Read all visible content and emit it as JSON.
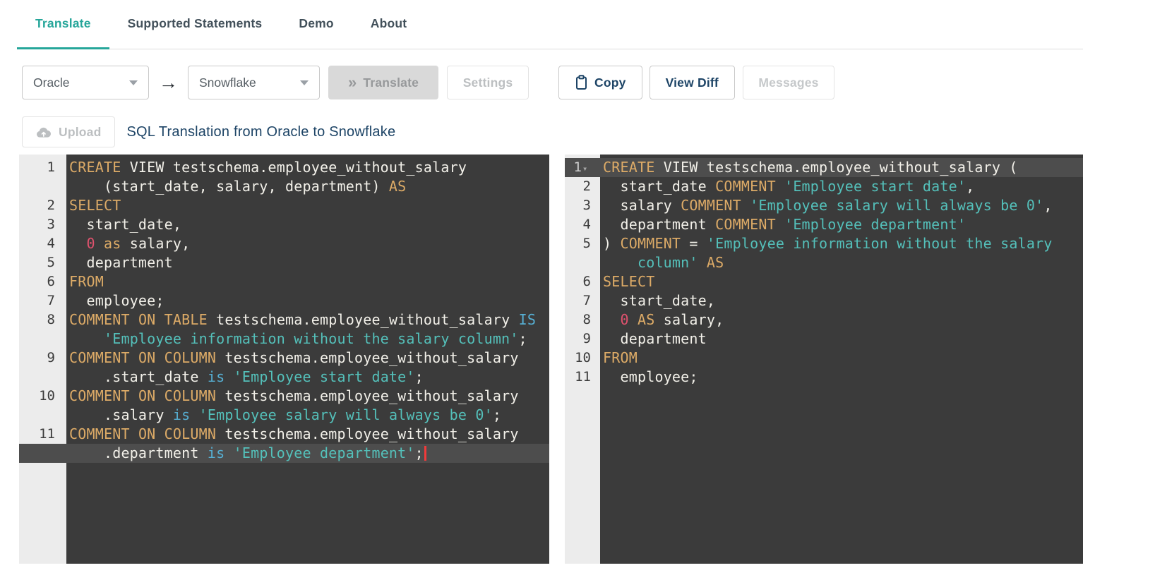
{
  "tabs": [
    {
      "label": "Translate",
      "active": true
    },
    {
      "label": "Supported Statements",
      "active": false
    },
    {
      "label": "Demo",
      "active": false
    },
    {
      "label": "About",
      "active": false
    }
  ],
  "toolbar": {
    "source_dialect": "Oracle",
    "target_dialect": "Snowflake",
    "arrow": "→",
    "translate_icon": "»",
    "translate_label": "Translate",
    "settings_label": "Settings",
    "copy_label": "Copy",
    "view_diff_label": "View Diff",
    "messages_label": "Messages"
  },
  "subheader": {
    "upload_label": "Upload",
    "title": "SQL Translation from Oracle to Snowflake"
  },
  "icons": {
    "fold": "▾"
  },
  "colors": {
    "accent": "#26a69a",
    "navy": "#1d4466",
    "editor-bg": "#3b3b3b",
    "gutter-bg": "#ececec",
    "gutter-text": "#3c3c3c",
    "active-line": "#4d4d4d",
    "tok-def": "#f2f0e9",
    "tok-kw": "#ddab67",
    "tok-str": "#54c0ba",
    "tok-kw2": "#56aed2",
    "tok-num": "#e0526e",
    "cursor": "#f23a3a"
  },
  "editors": [
    {
      "name": "source-editor",
      "rows": [
        {
          "n": "1",
          "seg": [
            [
              "kw",
              "CREATE"
            ],
            [
              "def",
              " VIEW testschema.employee_without_salary"
            ]
          ]
        },
        {
          "n": "",
          "seg": [
            [
              "def",
              "    (start_date, salary, department) "
            ],
            [
              "kw",
              "AS"
            ]
          ]
        },
        {
          "n": "2",
          "seg": [
            [
              "kw",
              "SELECT"
            ]
          ]
        },
        {
          "n": "3",
          "seg": [
            [
              "def",
              "  start_date,"
            ]
          ]
        },
        {
          "n": "4",
          "seg": [
            [
              "def",
              "  "
            ],
            [
              "num",
              "0"
            ],
            [
              "def",
              " "
            ],
            [
              "kw",
              "as"
            ],
            [
              "def",
              " salary,"
            ]
          ]
        },
        {
          "n": "5",
          "seg": [
            [
              "def",
              "  department"
            ]
          ]
        },
        {
          "n": "6",
          "seg": [
            [
              "kw",
              "FROM"
            ]
          ]
        },
        {
          "n": "7",
          "seg": [
            [
              "def",
              "  employee;"
            ]
          ]
        },
        {
          "n": "8",
          "seg": [
            [
              "kw",
              "COMMENT"
            ],
            [
              "def",
              " "
            ],
            [
              "kw",
              "ON"
            ],
            [
              "def",
              " "
            ],
            [
              "kw",
              "TABLE"
            ],
            [
              "def",
              " testschema.employee_without_salary "
            ],
            [
              "kw2",
              "IS"
            ]
          ]
        },
        {
          "n": "",
          "seg": [
            [
              "def",
              "    "
            ],
            [
              "str",
              "'Employee information without the salary column'"
            ],
            [
              "def",
              ";"
            ]
          ]
        },
        {
          "n": "9",
          "seg": [
            [
              "kw",
              "COMMENT"
            ],
            [
              "def",
              " "
            ],
            [
              "kw",
              "ON"
            ],
            [
              "def",
              " "
            ],
            [
              "kw",
              "COLUMN"
            ],
            [
              "def",
              " testschema.employee_without_salary"
            ]
          ]
        },
        {
          "n": "",
          "seg": [
            [
              "def",
              "    .start_date "
            ],
            [
              "kw2",
              "is"
            ],
            [
              "def",
              " "
            ],
            [
              "str",
              "'Employee start date'"
            ],
            [
              "def",
              ";"
            ]
          ]
        },
        {
          "n": "10",
          "seg": [
            [
              "kw",
              "COMMENT"
            ],
            [
              "def",
              " "
            ],
            [
              "kw",
              "ON"
            ],
            [
              "def",
              " "
            ],
            [
              "kw",
              "COLUMN"
            ],
            [
              "def",
              " testschema.employee_without_salary"
            ]
          ]
        },
        {
          "n": "",
          "seg": [
            [
              "def",
              "    .salary "
            ],
            [
              "kw2",
              "is"
            ],
            [
              "def",
              " "
            ],
            [
              "str",
              "'Employee salary will always be 0'"
            ],
            [
              "def",
              ";"
            ]
          ]
        },
        {
          "n": "11",
          "seg": [
            [
              "kw",
              "COMMENT"
            ],
            [
              "def",
              " "
            ],
            [
              "kw",
              "ON"
            ],
            [
              "def",
              " "
            ],
            [
              "kw",
              "COLUMN"
            ],
            [
              "def",
              " testschema.employee_without_salary"
            ]
          ]
        },
        {
          "n": "",
          "active": true,
          "cursor": true,
          "seg": [
            [
              "def",
              "    .department "
            ],
            [
              "kw2",
              "is"
            ],
            [
              "def",
              " "
            ],
            [
              "str",
              "'Employee department'"
            ],
            [
              "def",
              ";"
            ]
          ]
        }
      ]
    },
    {
      "name": "target-editor",
      "rows": [
        {
          "n": "1",
          "active": true,
          "fold": true,
          "seg": [
            [
              "kw",
              "CREATE"
            ],
            [
              "def",
              " VIEW testschema.employee_without_salary ("
            ]
          ]
        },
        {
          "n": "2",
          "seg": [
            [
              "def",
              "  start_date "
            ],
            [
              "kw",
              "COMMENT"
            ],
            [
              "def",
              " "
            ],
            [
              "str",
              "'Employee start date'"
            ],
            [
              "def",
              ","
            ]
          ]
        },
        {
          "n": "3",
          "seg": [
            [
              "def",
              "  salary "
            ],
            [
              "kw",
              "COMMENT"
            ],
            [
              "def",
              " "
            ],
            [
              "str",
              "'Employee salary will always be 0'"
            ],
            [
              "def",
              ","
            ]
          ]
        },
        {
          "n": "4",
          "seg": [
            [
              "def",
              "  department "
            ],
            [
              "kw",
              "COMMENT"
            ],
            [
              "def",
              " "
            ],
            [
              "str",
              "'Employee department'"
            ]
          ]
        },
        {
          "n": "5",
          "seg": [
            [
              "def",
              ") "
            ],
            [
              "kw",
              "COMMENT"
            ],
            [
              "def",
              " = "
            ],
            [
              "str",
              "'Employee information without the salary"
            ]
          ]
        },
        {
          "n": "",
          "seg": [
            [
              "str",
              "    column'"
            ],
            [
              "def",
              " "
            ],
            [
              "kw",
              "AS"
            ]
          ]
        },
        {
          "n": "6",
          "seg": [
            [
              "kw",
              "SELECT"
            ]
          ]
        },
        {
          "n": "7",
          "seg": [
            [
              "def",
              "  start_date,"
            ]
          ]
        },
        {
          "n": "8",
          "seg": [
            [
              "def",
              "  "
            ],
            [
              "num",
              "0"
            ],
            [
              "def",
              " "
            ],
            [
              "kw",
              "AS"
            ],
            [
              "def",
              " salary,"
            ]
          ]
        },
        {
          "n": "9",
          "seg": [
            [
              "def",
              "  department"
            ]
          ]
        },
        {
          "n": "10",
          "seg": [
            [
              "kw",
              "FROM"
            ]
          ]
        },
        {
          "n": "11",
          "seg": [
            [
              "def",
              "  employee;"
            ]
          ]
        }
      ]
    }
  ]
}
